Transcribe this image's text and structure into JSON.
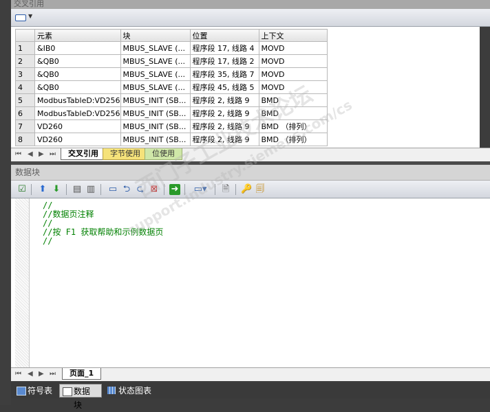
{
  "xref": {
    "title": "交叉引用",
    "columns": [
      "",
      "元素",
      "块",
      "位置",
      "上下文"
    ],
    "rows": [
      {
        "n": "1",
        "element": "&IB0",
        "block": "MBUS_SLAVE (...",
        "location": "程序段 17, 线路 4",
        "context": "MOVD"
      },
      {
        "n": "2",
        "element": "&QB0",
        "block": "MBUS_SLAVE (...",
        "location": "程序段 17, 线路 2",
        "context": "MOVD"
      },
      {
        "n": "3",
        "element": "&QB0",
        "block": "MBUS_SLAVE (...",
        "location": "程序段 35, 线路 7",
        "context": "MOVD"
      },
      {
        "n": "4",
        "element": "&QB0",
        "block": "MBUS_SLAVE (...",
        "location": "程序段 45, 线路 5",
        "context": "MOVD"
      },
      {
        "n": "5",
        "element": "ModbusTableD:VD256",
        "block": "MBUS_INIT (SB...",
        "location": "程序段 2, 线路 9",
        "context": "BMD"
      },
      {
        "n": "6",
        "element": "ModbusTableD:VD256",
        "block": "MBUS_INIT (SB...",
        "location": "程序段 2, 线路 9",
        "context": "BMD"
      },
      {
        "n": "7",
        "element": "VD260",
        "block": "MBUS_INIT (SB...",
        "location": "程序段 2, 线路 9",
        "context": "BMD （排列）"
      },
      {
        "n": "8",
        "element": "VD260",
        "block": "MBUS_INIT (SB...",
        "location": "程序段 2, 线路 9",
        "context": "BMD （排列）"
      }
    ],
    "tabs": [
      "交叉引用",
      "字节使用",
      "位使用"
    ]
  },
  "datablock": {
    "title": "数据块",
    "code": [
      "//",
      "//数据页注释",
      "//",
      "//按 F1 获取帮助和示例数据页",
      "//"
    ],
    "tabs": [
      "页面_1"
    ]
  },
  "bottom_tabs": [
    "符号表",
    "数据块",
    "状态图表"
  ],
  "watermark": [
    "西门子工业技术论坛",
    "support.industry.siemens.com/cs"
  ],
  "colors": {
    "comment_green": "#008000",
    "tab_yellow": "#f5e27a",
    "tab_green": "#cfe7a8"
  }
}
